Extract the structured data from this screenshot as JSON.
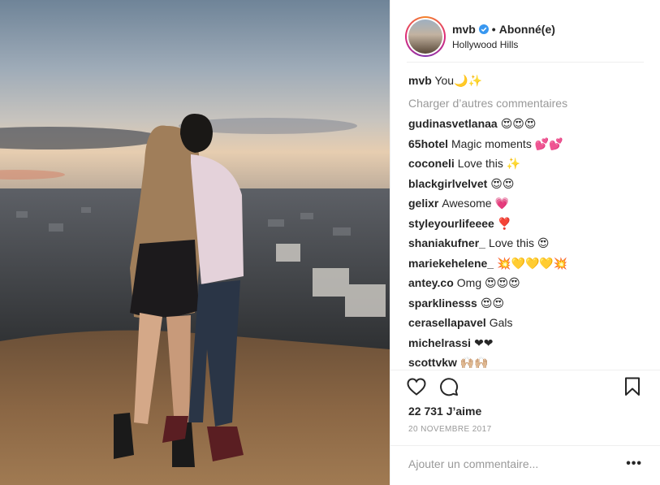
{
  "post": {
    "username": "mvb",
    "follow_status": "Abonné(e)",
    "location": "Hollywood Hills",
    "caption": {
      "user": "mvb",
      "text": "You🌙✨"
    },
    "load_more": "Charger d’autres commentaires",
    "comments": [
      {
        "user": "gudinasvetlanaa",
        "text": "😍😍😍"
      },
      {
        "user": "65hotel",
        "text": "Magic moments 💕💕"
      },
      {
        "user": "coconeli",
        "text": "Love this ✨"
      },
      {
        "user": "blackgirlvelvet",
        "text": "😍😍"
      },
      {
        "user": "gelixr",
        "text": "Awesome 💗"
      },
      {
        "user": "styleyourlifeeee",
        "text": "❣️"
      },
      {
        "user": "shaniakufner_",
        "text": "Love this 😍"
      },
      {
        "user": "mariekehelene_",
        "text": "💥💛💛💛💥"
      },
      {
        "user": "antey.co",
        "text": "Omg 😍😍😍"
      },
      {
        "user": "sparklinesss",
        "text": "😍😍"
      },
      {
        "user": "cerasellapavel",
        "text": "Gals"
      },
      {
        "user": "michelrassi",
        "text": "❤❤"
      },
      {
        "user": "scottvkw",
        "text": "🙌🏼🙌🏼"
      }
    ],
    "likes": "22 731 J’aime",
    "date": "20 NOVEMBRE 2017",
    "add_comment_placeholder": "Ajouter un commentaire...",
    "options_label": "•••",
    "verified_color": "#3897f0"
  }
}
